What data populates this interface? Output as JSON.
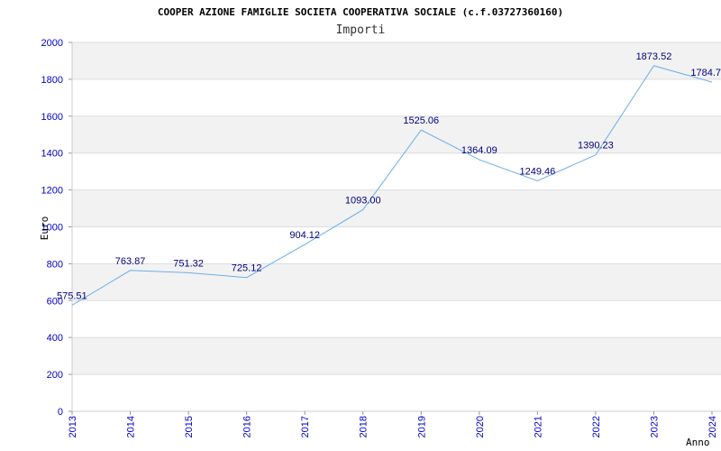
{
  "chart_data": {
    "type": "line",
    "title": "COOPER AZIONE FAMIGLIE SOCIETA COOPERATIVA SOCIALE (c.f.03727360160)",
    "subtitle": "Importi",
    "xlabel": "Anno",
    "ylabel": "Euro",
    "categories": [
      "2013",
      "2014",
      "2015",
      "2016",
      "2017",
      "2018",
      "2019",
      "2020",
      "2021",
      "2022",
      "2023",
      "2024"
    ],
    "series": [
      {
        "values": [
          575.51,
          763.87,
          751.32,
          725.12,
          904.12,
          1093.0,
          1525.06,
          1364.09,
          1249.46,
          1390.23,
          1873.52,
          1784.7
        ],
        "labels": [
          "575.51",
          "763.87",
          "751.32",
          "725.12",
          "904.12",
          "1093.00",
          "1525.06",
          "1364.09",
          "1249.46",
          "1390.23",
          "1873.52",
          "1784.7"
        ]
      }
    ],
    "yticks": [
      "0",
      "200",
      "400",
      "600",
      "800",
      "1000",
      "1200",
      "1400",
      "1600",
      "1800",
      "2000"
    ],
    "ylim": [
      0,
      2000
    ],
    "grid": true,
    "colors": {
      "line": "#6aaee8",
      "band": "#f2f2f2",
      "grid": "#dddddd",
      "tick_text": "#0000cc",
      "data_label": "#000080"
    }
  }
}
